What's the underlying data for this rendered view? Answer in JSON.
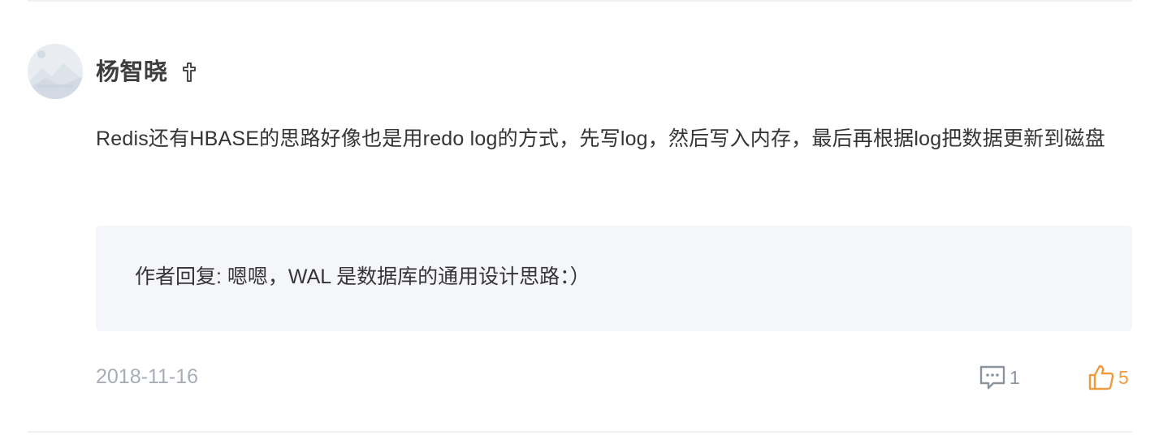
{
  "comment": {
    "username": "杨智晓",
    "badge_icon": "cross-badge-icon",
    "avatar_icon": "mountain-placeholder-avatar",
    "text": "Redis还有HBASE的思路好像也是用redo log的方式，先写log，然后写入内存，最后再根据log把数据更新到磁盘",
    "reply": {
      "label": "作者回复: ",
      "text": "嗯嗯，WAL 是数据库的通用设计思路：）"
    },
    "date": "2018-11-16",
    "reply_count": "1",
    "like_count": "5"
  },
  "colors": {
    "accent_like": "#f09a3e",
    "muted": "#8c939d",
    "reply_bg": "#f5f6fa"
  }
}
